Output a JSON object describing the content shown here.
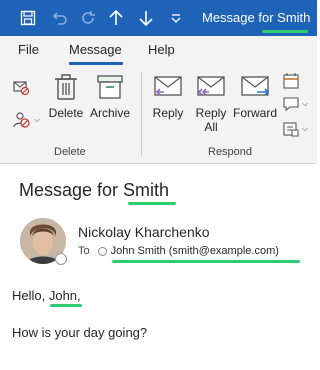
{
  "window": {
    "title": "Message for Smith"
  },
  "quick_access": {
    "icons": [
      "save-icon",
      "undo-icon",
      "redo-icon",
      "up-arrow-icon",
      "down-arrow-icon",
      "customize-icon"
    ]
  },
  "tabs": [
    {
      "label": "File"
    },
    {
      "label": "Message",
      "active": true
    },
    {
      "label": "Help"
    }
  ],
  "ribbon": {
    "delete_group": {
      "label": "Delete",
      "delete_label": "Delete",
      "archive_label": "Archive"
    },
    "respond_group": {
      "label": "Respond",
      "reply_label": "Reply",
      "reply_all_line1": "Reply",
      "reply_all_line2": "All",
      "forward_label": "Forward"
    }
  },
  "message": {
    "subject": "Message for Smith",
    "sender": "Nickolay Kharchenko",
    "to_label": "To",
    "recipient": "John Smith (smith@example.com)",
    "body": {
      "greeting": "Hello, John,",
      "line1": "How is your day going?"
    }
  },
  "colors": {
    "accent": "#1f63b8",
    "highlight": "#2ecc71",
    "ribbon_bg": "#f3f3f3",
    "reply_icon": "#8e6bbf",
    "forward_icon": "#2b78d0"
  }
}
